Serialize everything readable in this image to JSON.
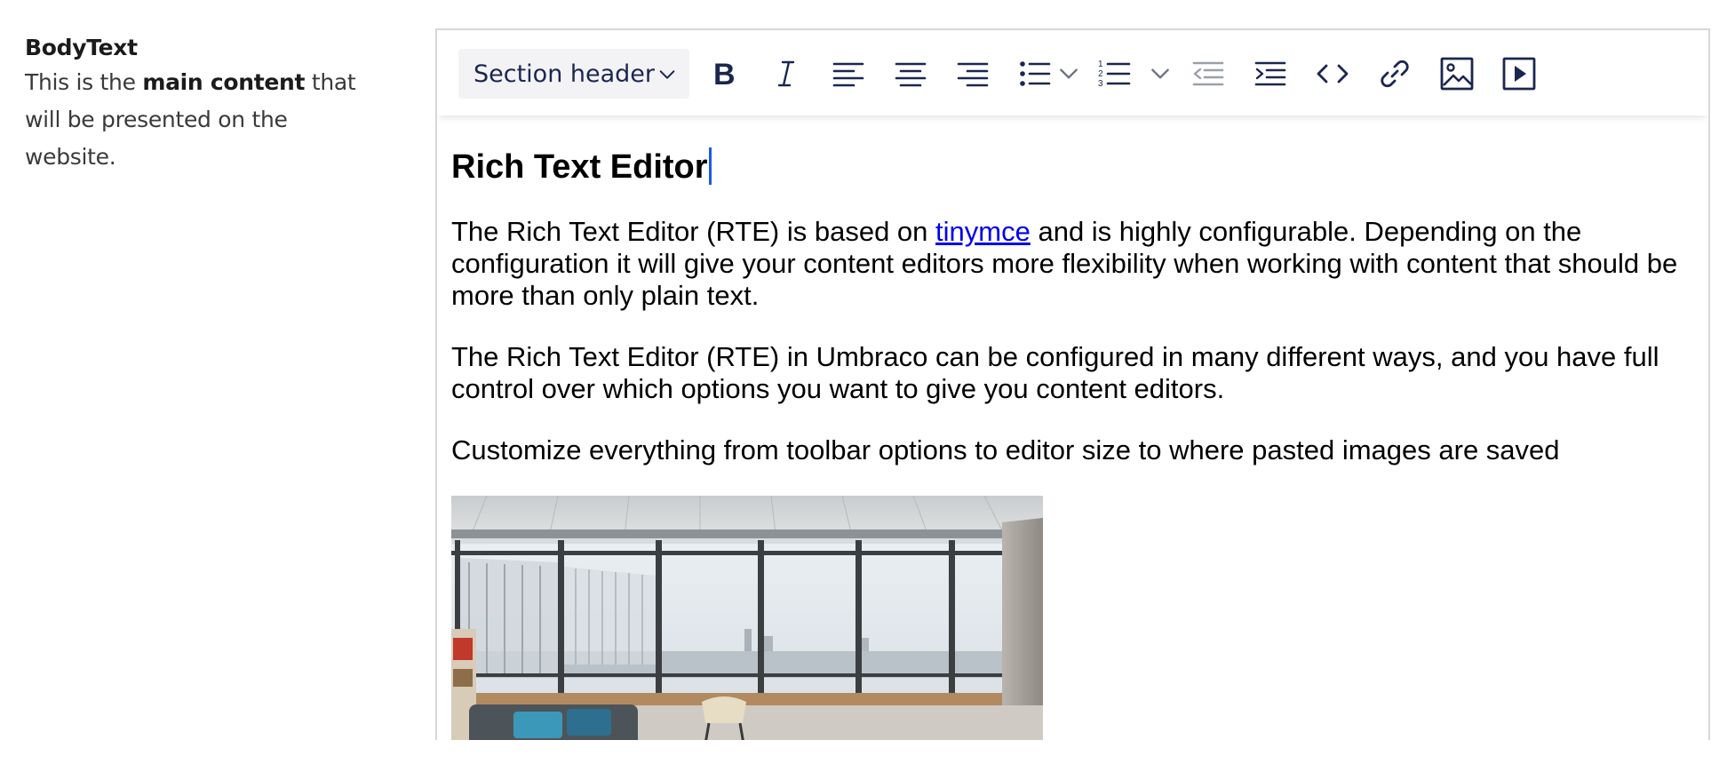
{
  "property": {
    "title": "BodyText",
    "desc_pre": "This is the ",
    "desc_bold": "main content",
    "desc_post": " that will be presented on the website."
  },
  "toolbar": {
    "format_select_value": "Section header",
    "buttons": [
      {
        "name": "bold-icon"
      },
      {
        "name": "italic-icon"
      },
      {
        "name": "align-left-icon"
      },
      {
        "name": "align-center-icon"
      },
      {
        "name": "align-right-icon"
      },
      {
        "name": "bullet-list-icon"
      },
      {
        "name": "numbered-list-icon"
      },
      {
        "name": "outdent-icon"
      },
      {
        "name": "indent-icon"
      },
      {
        "name": "source-code-icon"
      },
      {
        "name": "link-icon"
      },
      {
        "name": "image-icon"
      },
      {
        "name": "media-icon"
      }
    ]
  },
  "content": {
    "heading": "Rich Text Editor",
    "p1_pre": "The Rich Text Editor (RTE) is based on ",
    "p1_link": "tinymce",
    "p1_post": " and is highly configurable. Depending on the configuration it will give your content editors more flexibility when working with content that should be more than only plain text.",
    "p2": "The Rich Text Editor (RTE) in Umbraco can be configured in many different ways, and you have full control over which options you want to give you content editors.",
    "p3": "Customize everything from toolbar options to editor size to where pasted images are saved"
  },
  "colors": {
    "toolbar_icon": "#1b264f",
    "caret": "#1a5ae8",
    "link": "#0000ee",
    "frame_border": "#d8d7d9"
  }
}
